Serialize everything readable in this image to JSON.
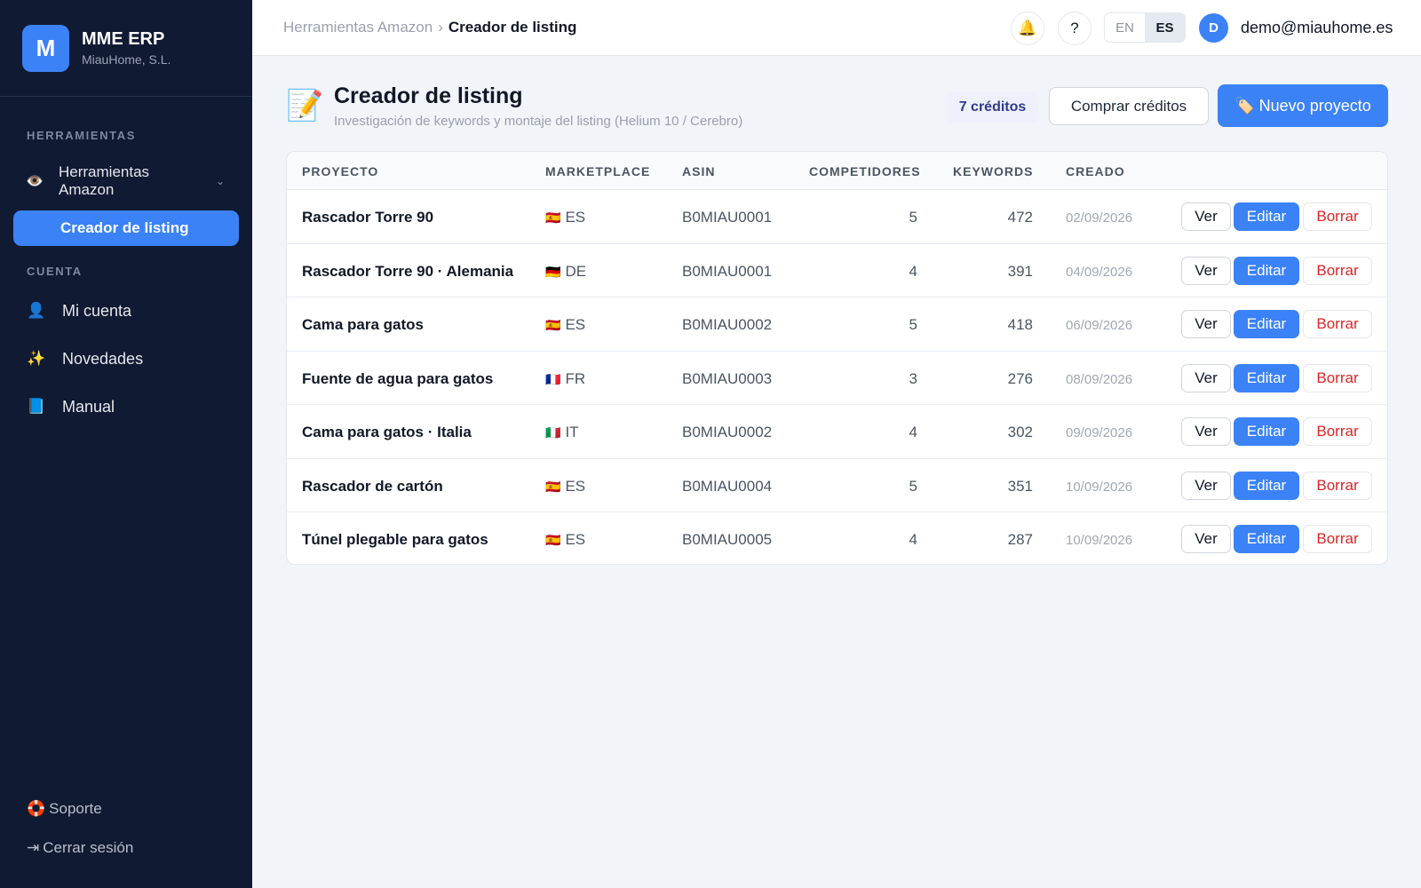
{
  "app": {
    "logo_letter": "M",
    "name": "MME ERP",
    "company": "MiauHome, S.L."
  },
  "sidebar": {
    "section_tools": "HERRAMIENTAS",
    "group_amazon": {
      "icon": "👁️",
      "label": "Herramientas Amazon",
      "chevron": "⌄"
    },
    "active_item": "Creador de listing",
    "section_account": "CUENTA",
    "items": [
      {
        "icon": "👤",
        "label": "Mi cuenta"
      },
      {
        "icon": "✨",
        "label": "Novedades"
      },
      {
        "icon": "📘",
        "label": "Manual"
      }
    ],
    "support": {
      "icon": "🛟",
      "label": "Soporte"
    },
    "logout": {
      "icon": "⇥",
      "label": "Cerrar sesión"
    }
  },
  "topbar": {
    "breadcrumb_parent": "Herramientas Amazon",
    "breadcrumb_sep": "›",
    "breadcrumb_current": "Creador de listing",
    "bell_icon": "🔔",
    "help_label": "?",
    "lang_en": "EN",
    "lang_es": "ES",
    "avatar_letter": "D",
    "user_email": "demo@miauhome.es"
  },
  "header": {
    "icon": "📝",
    "title": "Creador de listing",
    "subtitle": "Investigación de keywords y montaje del listing (Helium 10 / Cerebro)",
    "credits": "7 créditos",
    "buy_label": "Comprar créditos",
    "new_label": "🏷️ Nuevo proyecto"
  },
  "table": {
    "headers": [
      "PROYECTO",
      "MARKETPLACE",
      "ASIN",
      "COMPETIDORES",
      "KEYWORDS",
      "CREADO"
    ],
    "actions": {
      "view": "Ver",
      "edit": "Editar",
      "delete": "Borrar"
    },
    "rows": [
      {
        "name": "Rascador Torre 90",
        "flag": "🇪🇸",
        "market": "ES",
        "asin": "B0MIAU0001",
        "competitors": "5",
        "keywords": "472",
        "created": "02/09/2026"
      },
      {
        "name": "Rascador Torre 90 · Alemania",
        "flag": "🇩🇪",
        "market": "DE",
        "asin": "B0MIAU0001",
        "competitors": "4",
        "keywords": "391",
        "created": "04/09/2026"
      },
      {
        "name": "Cama para gatos",
        "flag": "🇪🇸",
        "market": "ES",
        "asin": "B0MIAU0002",
        "competitors": "5",
        "keywords": "418",
        "created": "06/09/2026"
      },
      {
        "name": "Fuente de agua para gatos",
        "flag": "🇫🇷",
        "market": "FR",
        "asin": "B0MIAU0003",
        "competitors": "3",
        "keywords": "276",
        "created": "08/09/2026"
      },
      {
        "name": "Cama para gatos · Italia",
        "flag": "🇮🇹",
        "market": "IT",
        "asin": "B0MIAU0002",
        "competitors": "4",
        "keywords": "302",
        "created": "09/09/2026"
      },
      {
        "name": "Rascador de cartón",
        "flag": "🇪🇸",
        "market": "ES",
        "asin": "B0MIAU0004",
        "competitors": "5",
        "keywords": "351",
        "created": "10/09/2026"
      },
      {
        "name": "Túnel plegable para gatos",
        "flag": "🇪🇸",
        "market": "ES",
        "asin": "B0MIAU0005",
        "competitors": "4",
        "keywords": "287",
        "created": "10/09/2026"
      }
    ]
  }
}
